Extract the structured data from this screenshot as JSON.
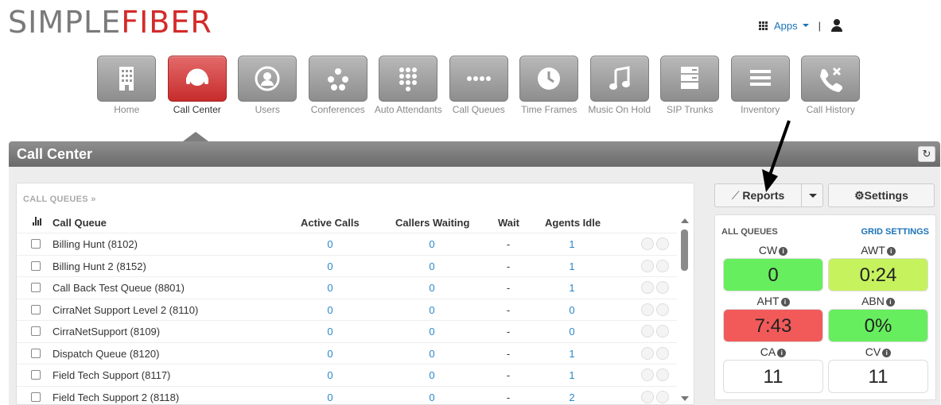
{
  "brand": {
    "part1": "SIMPLE",
    "part2": "FIBER"
  },
  "topright": {
    "apps_label": "Apps",
    "separator": "|"
  },
  "nav": [
    {
      "label": "Home",
      "icon": "building-icon",
      "active": false
    },
    {
      "label": "Call Center",
      "icon": "headset-icon",
      "active": true
    },
    {
      "label": "Users",
      "icon": "users-icon",
      "active": false
    },
    {
      "label": "Conferences",
      "icon": "conference-icon",
      "active": false
    },
    {
      "label": "Auto Attendants",
      "icon": "keypad-icon",
      "active": false
    },
    {
      "label": "Call Queues",
      "icon": "dots-icon",
      "active": false
    },
    {
      "label": "Time Frames",
      "icon": "clock-icon",
      "active": false
    },
    {
      "label": "Music On Hold",
      "icon": "music-note-icon",
      "active": false
    },
    {
      "label": "SIP Trunks",
      "icon": "server-icon",
      "active": false
    },
    {
      "label": "Inventory",
      "icon": "list-icon",
      "active": false
    },
    {
      "label": "Call History",
      "icon": "phone-arrows-icon",
      "active": false
    }
  ],
  "page": {
    "title": "Call Center"
  },
  "queues": {
    "section_title": "CALL QUEUES »",
    "columns": [
      "Call Queue",
      "Active Calls",
      "Callers Waiting",
      "Wait",
      "Agents Idle"
    ],
    "rows": [
      {
        "name": "Billing Hunt (8102)",
        "active": "0",
        "waiting": "0",
        "wait": "-",
        "idle": "1"
      },
      {
        "name": "Billing Hunt 2 (8152)",
        "active": "0",
        "waiting": "0",
        "wait": "-",
        "idle": "1"
      },
      {
        "name": "Call Back Test Queue (8801)",
        "active": "0",
        "waiting": "0",
        "wait": "-",
        "idle": "1"
      },
      {
        "name": "CirraNet Support Level 2 (8110)",
        "active": "0",
        "waiting": "0",
        "wait": "-",
        "idle": "0"
      },
      {
        "name": "CirraNetSupport (8109)",
        "active": "0",
        "waiting": "0",
        "wait": "-",
        "idle": "0"
      },
      {
        "name": "Dispatch Queue (8120)",
        "active": "0",
        "waiting": "0",
        "wait": "-",
        "idle": "1"
      },
      {
        "name": "Field Tech Support (8117)",
        "active": "0",
        "waiting": "0",
        "wait": "-",
        "idle": "1"
      },
      {
        "name": "Field Tech Support 2 (8118)",
        "active": "0",
        "waiting": "0",
        "wait": "-",
        "idle": "2"
      }
    ]
  },
  "actions": {
    "reports_label": "Reports",
    "settings_label": "Settings"
  },
  "stats": {
    "title": "ALL QUEUES",
    "grid_settings": "GRID SETTINGS",
    "items": [
      {
        "label": "CW",
        "value": "0",
        "color": "#66ee5e"
      },
      {
        "label": "AWT",
        "value": "0:24",
        "color": "#c6f25e"
      },
      {
        "label": "AHT",
        "value": "7:43",
        "color": "#f25a5a"
      },
      {
        "label": "ABN",
        "value": "0%",
        "color": "#66ee5e"
      },
      {
        "label": "CA",
        "value": "11",
        "color": "#ffffff"
      },
      {
        "label": "CV",
        "value": "11",
        "color": "#ffffff"
      }
    ]
  },
  "colors": {
    "brand_red": "#d42a2a",
    "link_blue": "#1a73b8",
    "active_tile": "#c72c2c"
  }
}
